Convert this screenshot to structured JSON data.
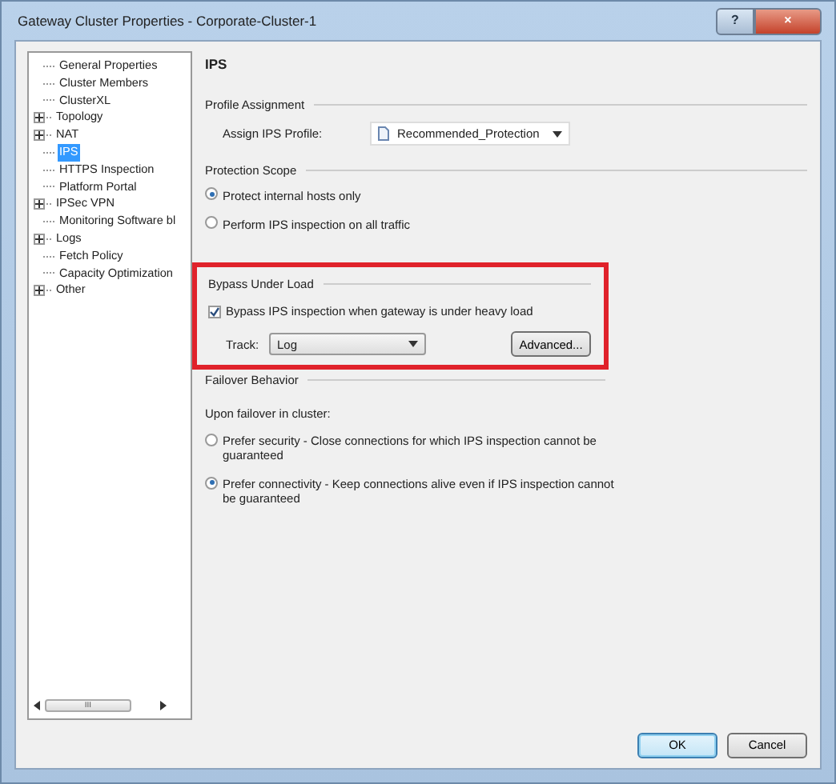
{
  "window": {
    "title": "Gateway Cluster Properties - Corporate-Cluster-1",
    "help_button": "?",
    "close_button": "×"
  },
  "tree": {
    "items": [
      {
        "label": "General Properties",
        "kind": "leaf",
        "selected": false
      },
      {
        "label": "Cluster Members",
        "kind": "leaf",
        "selected": false
      },
      {
        "label": "ClusterXL",
        "kind": "leaf",
        "selected": false
      },
      {
        "label": "Topology",
        "kind": "group",
        "selected": false
      },
      {
        "label": "NAT",
        "kind": "group",
        "selected": false
      },
      {
        "label": "IPS",
        "kind": "leaf",
        "selected": true
      },
      {
        "label": "HTTPS Inspection",
        "kind": "leaf",
        "selected": false
      },
      {
        "label": "Platform Portal",
        "kind": "leaf",
        "selected": false
      },
      {
        "label": "IPSec VPN",
        "kind": "group",
        "selected": false
      },
      {
        "label": "Monitoring Software bl",
        "kind": "leaf",
        "selected": false
      },
      {
        "label": "Logs",
        "kind": "group",
        "selected": false
      },
      {
        "label": "Fetch Policy",
        "kind": "leaf",
        "selected": false
      },
      {
        "label": "Capacity Optimization",
        "kind": "leaf",
        "selected": false
      },
      {
        "label": "Other",
        "kind": "group",
        "selected": false
      }
    ],
    "scrollbar_grip": "III"
  },
  "page": {
    "title": "IPS",
    "profile_assignment": {
      "heading": "Profile Assignment",
      "label": "Assign IPS Profile:",
      "value": "Recommended_Protection"
    },
    "protection_scope": {
      "heading": "Protection Scope",
      "options": [
        {
          "label": "Protect internal hosts only",
          "selected": true
        },
        {
          "label": "Perform IPS inspection on all traffic",
          "selected": false
        }
      ]
    },
    "bypass_under_load": {
      "heading": "Bypass Under Load",
      "highlighted": true,
      "checkbox": {
        "label": "Bypass IPS inspection when gateway is under heavy load",
        "checked": true
      },
      "track_label": "Track:",
      "track_value": "Log",
      "advanced_button": "Advanced..."
    },
    "failover_behavior": {
      "heading": "Failover Behavior",
      "intro": "Upon failover in cluster:",
      "options": [
        {
          "label": "Prefer security - Close connections for which IPS inspection cannot be guaranteed",
          "selected": false
        },
        {
          "label": "Prefer connectivity - Keep connections alive even if IPS inspection cannot be guaranteed",
          "selected": true
        }
      ]
    }
  },
  "buttons": [
    {
      "label": "OK",
      "kind": "default"
    },
    {
      "label": "Cancel",
      "kind": "normal"
    }
  ]
}
